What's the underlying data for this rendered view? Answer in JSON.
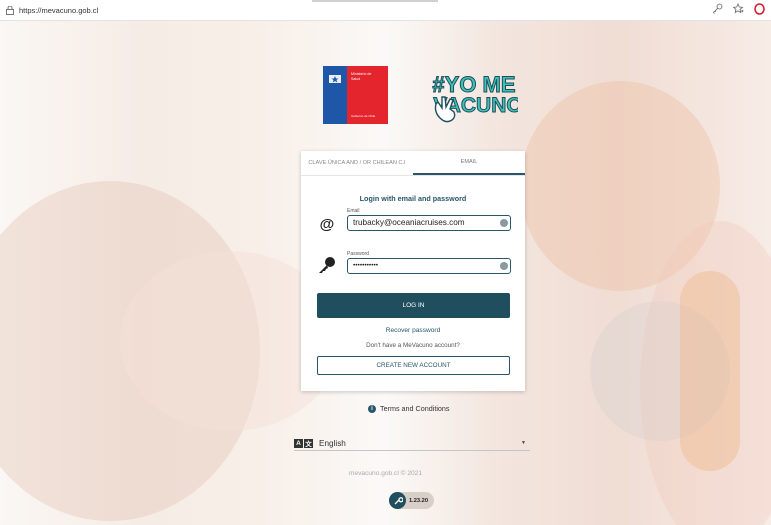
{
  "browser": {
    "url": "https://mevacuno.gob.cl"
  },
  "logos": {
    "ministry_line1": "Ministerio de",
    "ministry_line2": "Salud",
    "ministry_footer": "Gobierno de Chile",
    "campaign_line1": "#YO ME",
    "campaign_line2": "VACUNO"
  },
  "login": {
    "tabs": [
      {
        "label": "CLAVE ÚNICA AND / OR CHILEAN C.I",
        "active": false
      },
      {
        "label": "EMAIL",
        "active": true
      }
    ],
    "title": "Login with email and password",
    "email_label": "Email",
    "email_value": "trubacky@oceaniacruises.com",
    "password_label": "Password",
    "password_value": "•••••••••••",
    "login_button": "LOG IN",
    "recover_link": "Recover password",
    "no_account_text": "Don't have a MeVacuno account?",
    "create_button": "CREATE NEW ACCOUNT"
  },
  "terms": "Terms and Conditions",
  "language": {
    "selected": "English",
    "icon_a": "A",
    "icon_b": "文"
  },
  "footer": "mevacuno.gob.cl © 2021",
  "version": "1.23.20",
  "colors": {
    "primary": "#1f4e5f",
    "ministry_blue": "#1f57a8",
    "ministry_red": "#e4252d",
    "campaign_teal": "#3ec2b4"
  }
}
